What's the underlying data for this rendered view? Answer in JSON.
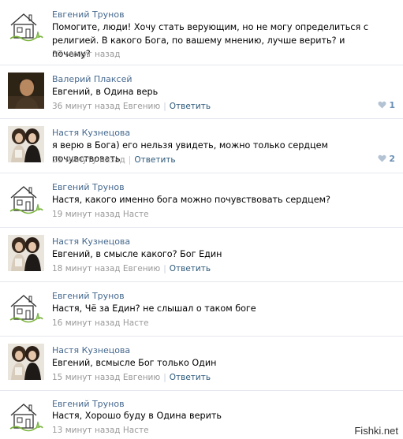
{
  "comments": [
    {
      "author": "Евгений Трунов",
      "avatar": "house-icon",
      "text": "Помогите, люди! Хочу стать верующим, но не могу определиться с религией. В какого Бога, по вашему мнению, лучше верить? и почему?",
      "time": "37 минут назад",
      "reply_to": "",
      "reply_label": "",
      "likes": ""
    },
    {
      "author": "Валерий Плаксей",
      "avatar": "man-photo",
      "text": "Евгений, в Одина верь",
      "time": "36 минут назад Евгению",
      "reply_to": "",
      "reply_label": "Ответить",
      "likes": "1"
    },
    {
      "author": "Настя Кузнецова",
      "avatar": "two-girls-photo",
      "text": "я верю в Бога) его нельзя увидеть, можно только сердцем почувствовать",
      "time": "21 минуту назад",
      "reply_to": "",
      "reply_label": "Ответить",
      "likes": "2"
    },
    {
      "author": "Евгений Трунов",
      "avatar": "house-icon",
      "text": "Настя, какого именно бога можно почувствовать сердцем?",
      "time": "19 минут назад Насте",
      "reply_to": "",
      "reply_label": "",
      "likes": ""
    },
    {
      "author": "Настя Кузнецова",
      "avatar": "two-girls-photo",
      "text": "Евгений, в смысле какого? Бог Един",
      "time": "18 минут назад Евгению",
      "reply_to": "",
      "reply_label": "Ответить",
      "likes": ""
    },
    {
      "author": "Евгений Трунов",
      "avatar": "house-icon",
      "text": "Настя, Чё за Един? не слышал о таком боге",
      "time": "16 минут назад Насте",
      "reply_to": "",
      "reply_label": "",
      "likes": ""
    },
    {
      "author": "Настя Кузнецова",
      "avatar": "two-girls-photo",
      "text": "Евгений, всмысле Бог только Один",
      "time": "15 минут назад Евгению",
      "reply_to": "",
      "reply_label": "Ответить",
      "likes": ""
    },
    {
      "author": "Евгений Трунов",
      "avatar": "house-icon",
      "text": "Настя, Хорошо буду в Одина верить",
      "time": "13 минут назад Насте",
      "reply_to": "",
      "reply_label": "",
      "likes": ""
    }
  ],
  "watermark": "Fishki.net",
  "colors": {
    "author": "#45688e",
    "meta": "#999999",
    "reply": "#2b587a",
    "separator": "#e4e8ec"
  }
}
